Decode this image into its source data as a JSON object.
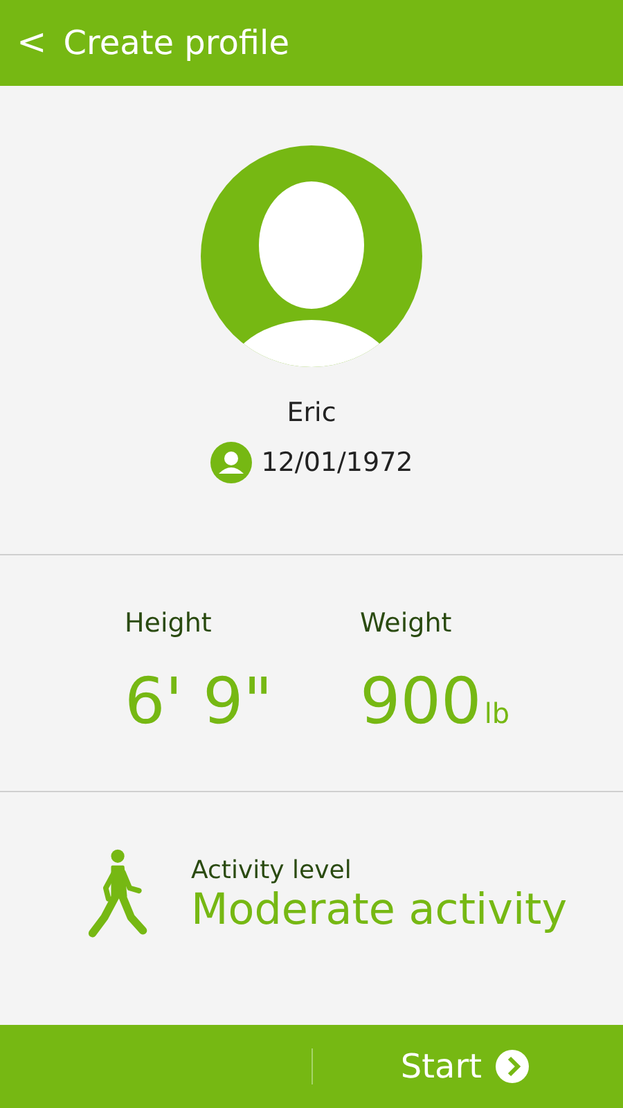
{
  "header": {
    "back": "<",
    "title": "Create profile"
  },
  "profile": {
    "name": "Eric",
    "birthdate": "12/01/1972"
  },
  "measurements": [
    {
      "label": "Height",
      "value": "6' 9\""
    },
    {
      "label": "Weight",
      "value": "900",
      "unit": "lb"
    }
  ],
  "activity": {
    "label": "Activity level",
    "value": "Moderate activity"
  },
  "footer": {
    "button": "Start"
  }
}
